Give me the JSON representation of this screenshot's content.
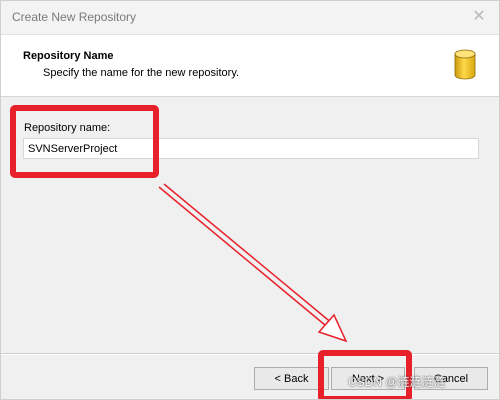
{
  "window": {
    "title": "Create New Repository"
  },
  "header": {
    "title": "Repository Name",
    "subtitle": "Specify the name for the new repository.",
    "icon": "database-icon"
  },
  "form": {
    "repository_name_label": "Repository name:",
    "repository_name_value": "SVNServerProject"
  },
  "buttons": {
    "back_label": "< Back",
    "next_label": "Next >",
    "cancel_label": "Cancel"
  },
  "watermark": {
    "text": "CSDN @涟涟涟涟"
  },
  "colors": {
    "annotation_red": "#e8202a",
    "icon_yellow": "#f2c21b"
  }
}
